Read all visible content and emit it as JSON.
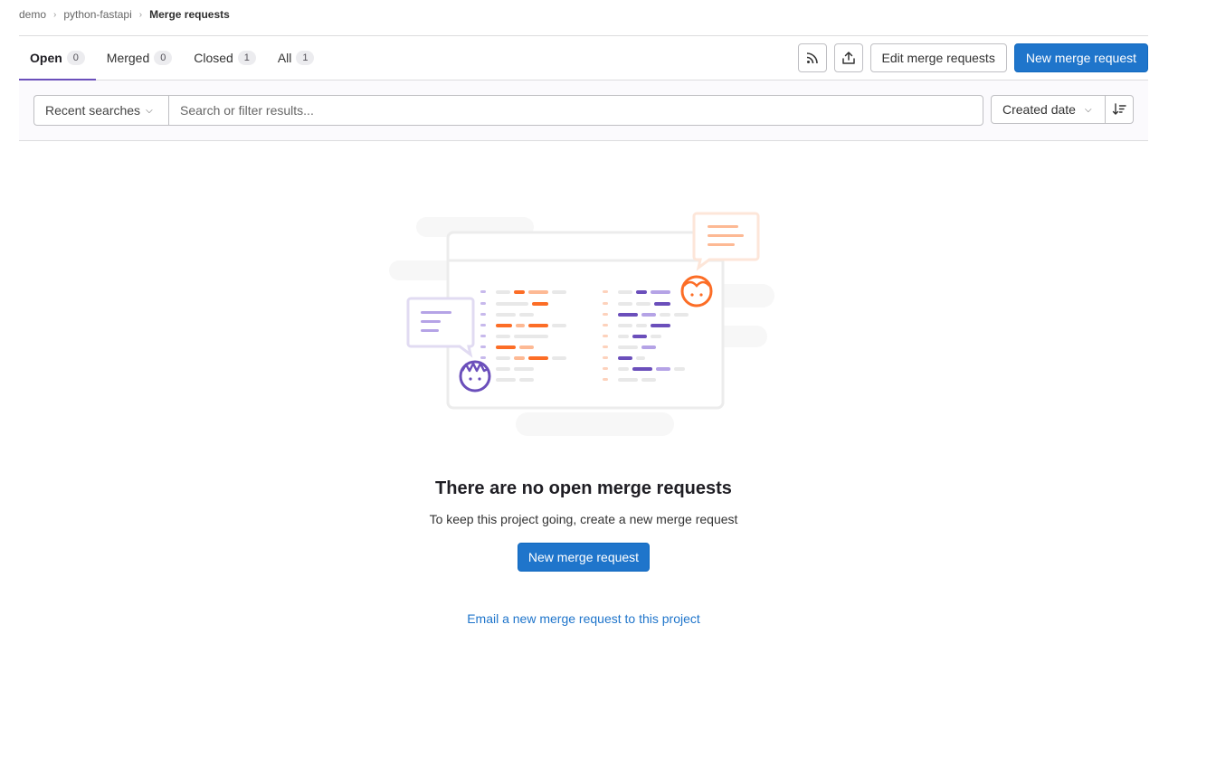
{
  "breadcrumb": {
    "items": [
      "demo",
      "python-fastapi"
    ],
    "current": "Merge requests"
  },
  "tabs": [
    {
      "label": "Open",
      "count": "0"
    },
    {
      "label": "Merged",
      "count": "0"
    },
    {
      "label": "Closed",
      "count": "1"
    },
    {
      "label": "All",
      "count": "1"
    }
  ],
  "actions": {
    "rss_icon": "rss-icon",
    "export_icon": "export-icon",
    "edit_label": "Edit merge requests",
    "new_label": "New merge request"
  },
  "filter": {
    "recent_label": "Recent searches",
    "search_placeholder": "Search or filter results...",
    "sort_label": "Created date",
    "sort_dir_icon": "sort-lowest-icon"
  },
  "empty_state": {
    "title": "There are no open merge requests",
    "description": "To keep this project going, create a new merge request",
    "button_label": "New merge request",
    "email_link": "Email a new merge request to this project"
  },
  "colors": {
    "primary": "#1f75cb",
    "active_tab_underline": "#6b4fbb",
    "illustration_orange": "#fc6d26",
    "illustration_purple": "#6b4fbb"
  }
}
